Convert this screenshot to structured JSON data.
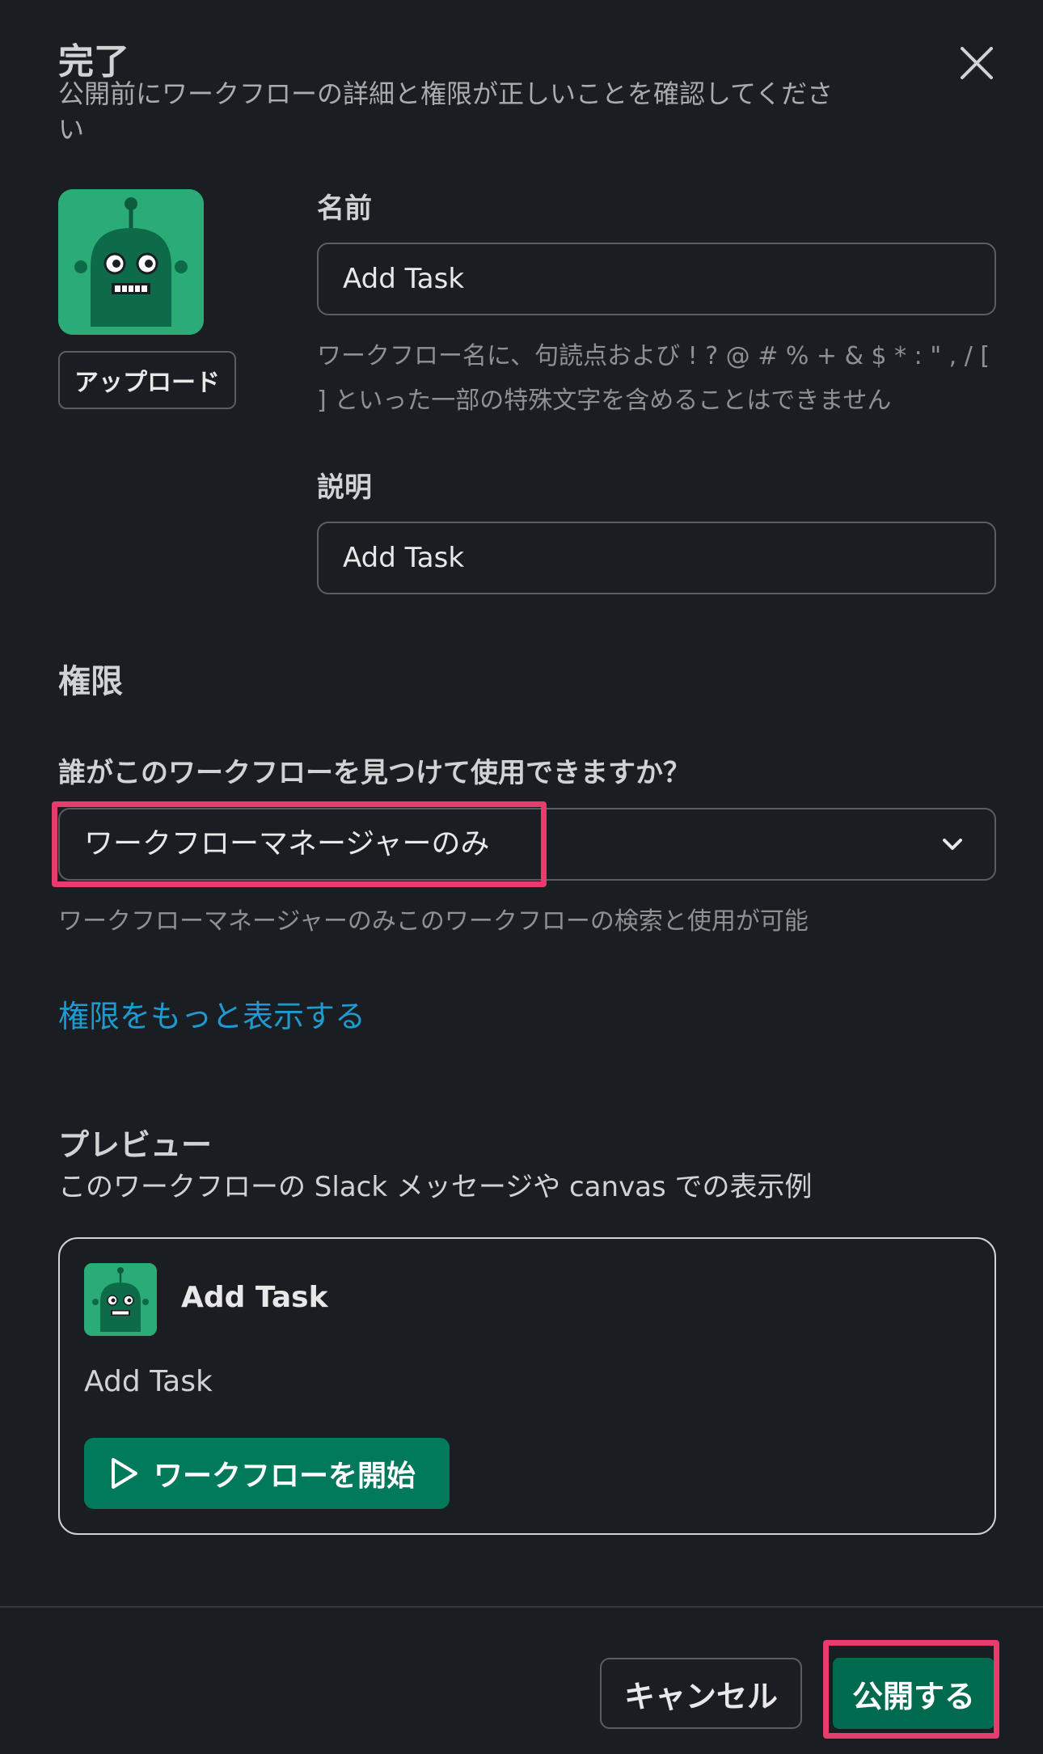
{
  "header": {
    "title": "完了",
    "subtitle": "公開前にワークフローの詳細と権限が正しいことを確認してください"
  },
  "app": {
    "upload_label": "アップロード"
  },
  "form": {
    "name_label": "名前",
    "name_value": "Add Task",
    "name_hint_1": "ワークフロー名に、句読点および ! ? @ # % + & $ * : \" , / [",
    "name_hint_2": "] といった一部の特殊文字を含めることはできません",
    "description_label": "説明",
    "description_value": "Add Task"
  },
  "permissions": {
    "section_title": "権限",
    "question": "誰がこのワークフローを見つけて使用できますか？",
    "selected": "ワークフローマネージャーのみ",
    "help": "ワークフローマネージャーのみこのワークフローの検索と使用が可能",
    "more_link": "権限をもっと表示する"
  },
  "preview": {
    "section_title": "プレビュー",
    "subtitle": "このワークフローの Slack メッセージや canvas での表示例",
    "card_title": "Add Task",
    "card_body": "Add Task",
    "start_button": "ワークフローを開始"
  },
  "footer": {
    "cancel_label": "キャンセル",
    "publish_label": "公開する"
  },
  "colors": {
    "background": "#1a1d21",
    "accent_green": "#007a5a",
    "icon_green": "#2bac76",
    "link_blue": "#1d9bd1",
    "highlight_pink": "#ea3b6e"
  },
  "icons": {
    "close": "close-icon",
    "chevron": "chevron-down-icon",
    "play": "play-icon",
    "app": "robot-app-icon"
  }
}
